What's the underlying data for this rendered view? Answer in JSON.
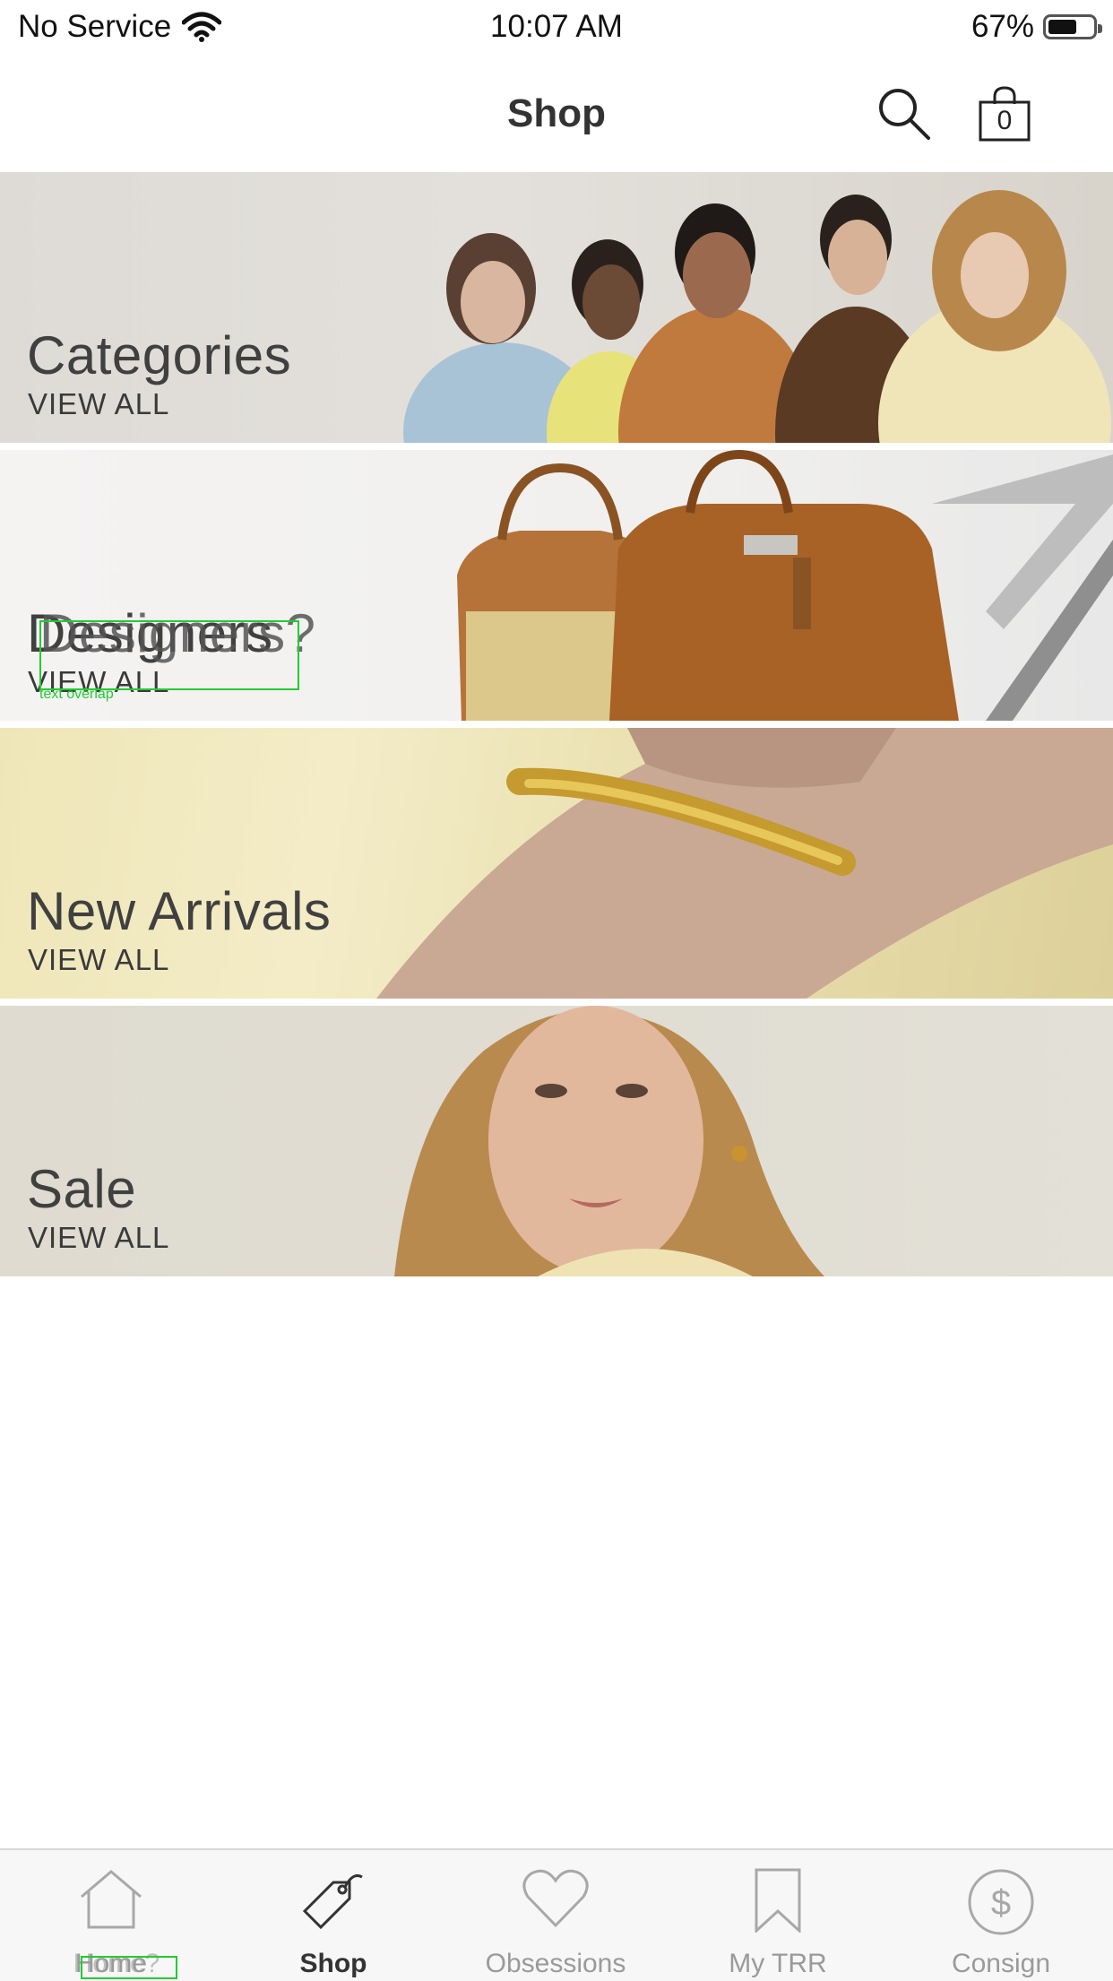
{
  "status": {
    "carrier": "No Service",
    "time": "10:07 AM",
    "battery": "67%"
  },
  "header": {
    "title": "Shop",
    "cart_count": "0"
  },
  "banners": [
    {
      "label": "Categories",
      "action": "VIEW ALL"
    },
    {
      "label": "Designers",
      "action": "VIEW ALL",
      "overlap_label": "Designers?"
    },
    {
      "label": "New Arrivals",
      "action": "VIEW ALL"
    },
    {
      "label": "Sale",
      "action": "VIEW ALL"
    }
  ],
  "annotations": {
    "overlap_note": "text overlap"
  },
  "tabs": [
    {
      "label": "Home",
      "overlap": "Home?"
    },
    {
      "label": "Shop"
    },
    {
      "label": "Obsessions"
    },
    {
      "label": "My TRR"
    },
    {
      "label": "Consign"
    }
  ],
  "colors": {
    "text": "#333333",
    "tab_inactive": "#9a9a9a",
    "annotation": "#22cc33"
  }
}
